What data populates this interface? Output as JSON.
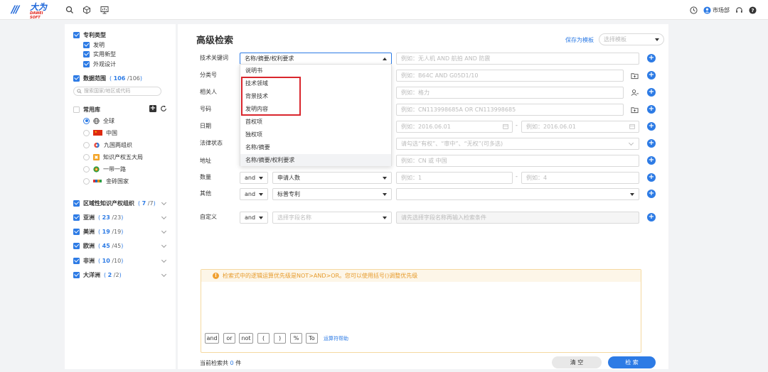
{
  "header": {
    "logo_cn": "大为",
    "logo_en": "DAWEI SOFT",
    "user": "市场部"
  },
  "sidebar": {
    "patent_type": {
      "label": "专利类型",
      "items": [
        "发明",
        "实用新型",
        "外观设计"
      ]
    },
    "data_range": {
      "label": "数据范围",
      "selected": "106",
      "total": "/106"
    },
    "search_placeholder": "搜索国家/地区或代码",
    "common_lib": {
      "label": "常用库",
      "items": [
        "全球",
        "中国",
        "九国两组织",
        "知识产权五大局",
        "一带一路",
        "金砖国家"
      ]
    },
    "regions": [
      {
        "label": "区域性知识产权组织",
        "selected": "7",
        "total": "/7"
      },
      {
        "label": "亚洲",
        "selected": "23",
        "total": "/23"
      },
      {
        "label": "美洲",
        "selected": "19",
        "total": "/19"
      },
      {
        "label": "欧洲",
        "selected": "45",
        "total": "/45"
      },
      {
        "label": "非洲",
        "selected": "10",
        "total": "/10"
      },
      {
        "label": "大洋洲",
        "selected": "2",
        "total": "/2"
      }
    ]
  },
  "main": {
    "title": "高级检索",
    "save_template": "保存为模板",
    "template_placeholder": "选择模板",
    "rows": {
      "keyword": {
        "label": "技术关键词",
        "field": "名称/摘要/权利要求",
        "placeholder": "例如：无人机 AND 航拍 AND 防震"
      },
      "classification": {
        "label": "分类号",
        "placeholder": "例如：B64C AND G05D1/10"
      },
      "person": {
        "label": "相关人",
        "placeholder": "例如：格力"
      },
      "number": {
        "label": "号码",
        "placeholder": "例如：CN113998685A OR CN113998685"
      },
      "date": {
        "label": "日期",
        "from_placeholder": "例如：2016.06.01",
        "to_placeholder": "例如：2016.06.01"
      },
      "legal": {
        "label": "法律状态",
        "placeholder": "请勾选“有权”、“审中”、“无权”(可多选)"
      },
      "address": {
        "label": "地址",
        "placeholder": "例如：CN 或 中国"
      },
      "quantity": {
        "label": "数量",
        "op": "and",
        "field": "申请人数",
        "from_placeholder": "例如：1",
        "to_placeholder": "例如：4"
      },
      "other": {
        "label": "其他",
        "op": "and",
        "field": "标普专利"
      },
      "custom": {
        "label": "自定义",
        "op": "and",
        "field_placeholder": "选择字段名称",
        "value_placeholder": "请先选择字段名称再输入检索条件"
      }
    },
    "date_separator": "-",
    "dropdown_items": [
      "说明书",
      "技术领域",
      "背景技术",
      "发明内容",
      "首权项",
      "独权项",
      "名称/摘要",
      "名称/摘要/权利要求"
    ],
    "tip": "检索式中的逻辑运算优先级是NOT>AND>OR。您可以使用括号()调整优先级",
    "operators": [
      "and",
      "or",
      "not",
      "(",
      ")",
      "%",
      "To"
    ],
    "operator_help": "运算符帮助",
    "count_prefix": "当前检索共",
    "count_value": "0",
    "count_suffix": "件",
    "clear_label": "清 空",
    "search_label": "检 索"
  },
  "colors": {
    "primary": "#2d7be5",
    "highlight": "#d9262d",
    "warning": "#f0a030"
  }
}
